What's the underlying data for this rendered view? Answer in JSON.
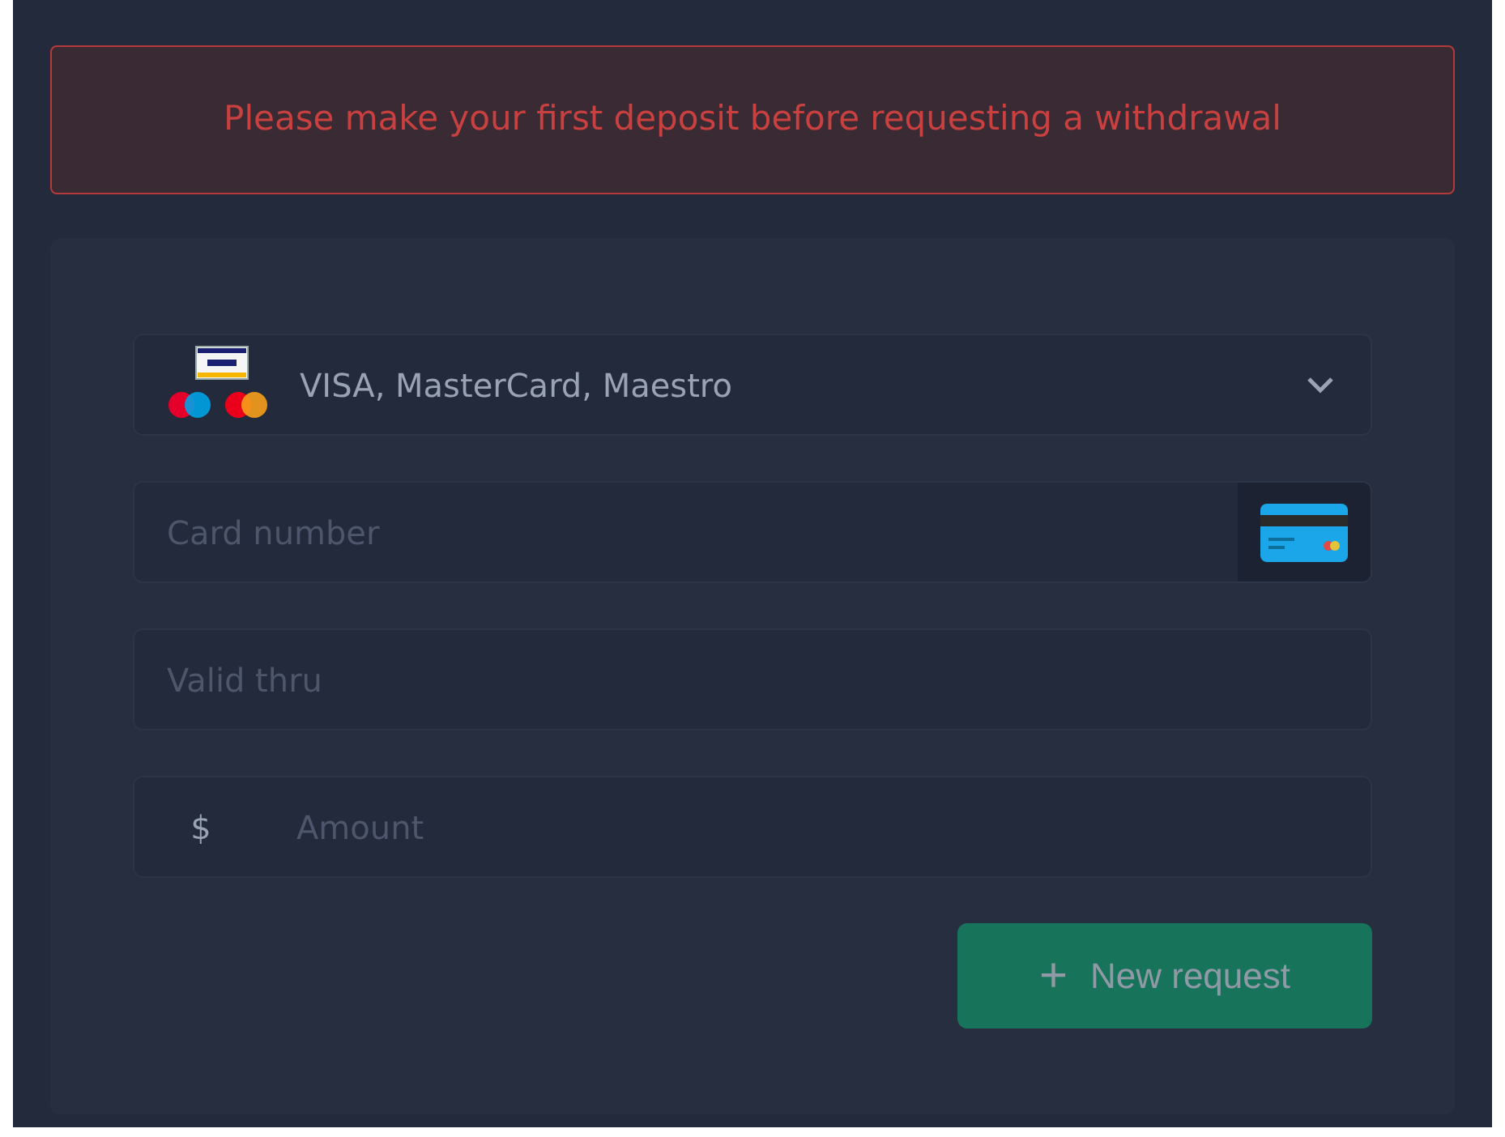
{
  "alert": {
    "message": "Please make your first deposit before requesting a withdrawal"
  },
  "form": {
    "method": {
      "value": "VISA, MasterCard, Maestro"
    },
    "card_number": {
      "placeholder": "Card number"
    },
    "valid_thru": {
      "placeholder": "Valid thru"
    },
    "amount": {
      "prefix": "$",
      "placeholder": "Amount"
    },
    "submit": {
      "icon": "+",
      "label": "New request",
      "disabled": true
    }
  }
}
